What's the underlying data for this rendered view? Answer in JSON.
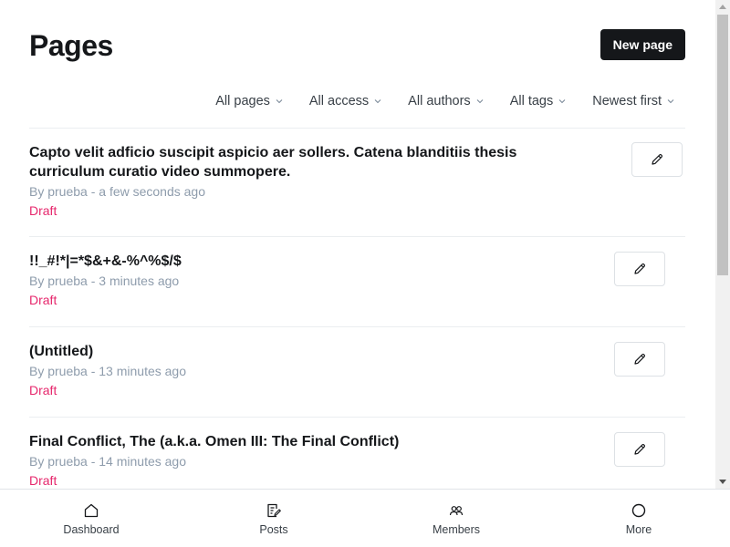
{
  "header": {
    "title": "Pages",
    "new_button_label": "New page"
  },
  "filters": [
    {
      "label": "All pages"
    },
    {
      "label": "All access"
    },
    {
      "label": "All authors"
    },
    {
      "label": "All tags"
    },
    {
      "label": "Newest first"
    }
  ],
  "pages": [
    {
      "title": "Capto velit adficio suscipit aspicio aer sollers. Catena blanditiis thesis curriculum curatio video summopere.",
      "meta": "By prueba - a few seconds ago",
      "status": "Draft"
    },
    {
      "title": "!!_#!*|=*$&+&-%^%$/$",
      "meta": "By prueba - 3 minutes ago",
      "status": "Draft"
    },
    {
      "title": "(Untitled)",
      "meta": "By prueba - 13 minutes ago",
      "status": "Draft"
    },
    {
      "title": "Final Conflict, The (a.k.a. Omen III: The Final Conflict)",
      "meta": "By prueba - 14 minutes ago",
      "status": "Draft"
    }
  ],
  "bottom_nav": [
    {
      "label": "Dashboard",
      "icon": "home-icon"
    },
    {
      "label": "Posts",
      "icon": "posts-icon"
    },
    {
      "label": "Members",
      "icon": "members-icon"
    },
    {
      "label": "More",
      "icon": "more-circle-icon"
    }
  ],
  "colors": {
    "primary": "#15171a",
    "muted": "#8e9cac",
    "draft": "#e6276c",
    "border": "#ebeef0"
  }
}
